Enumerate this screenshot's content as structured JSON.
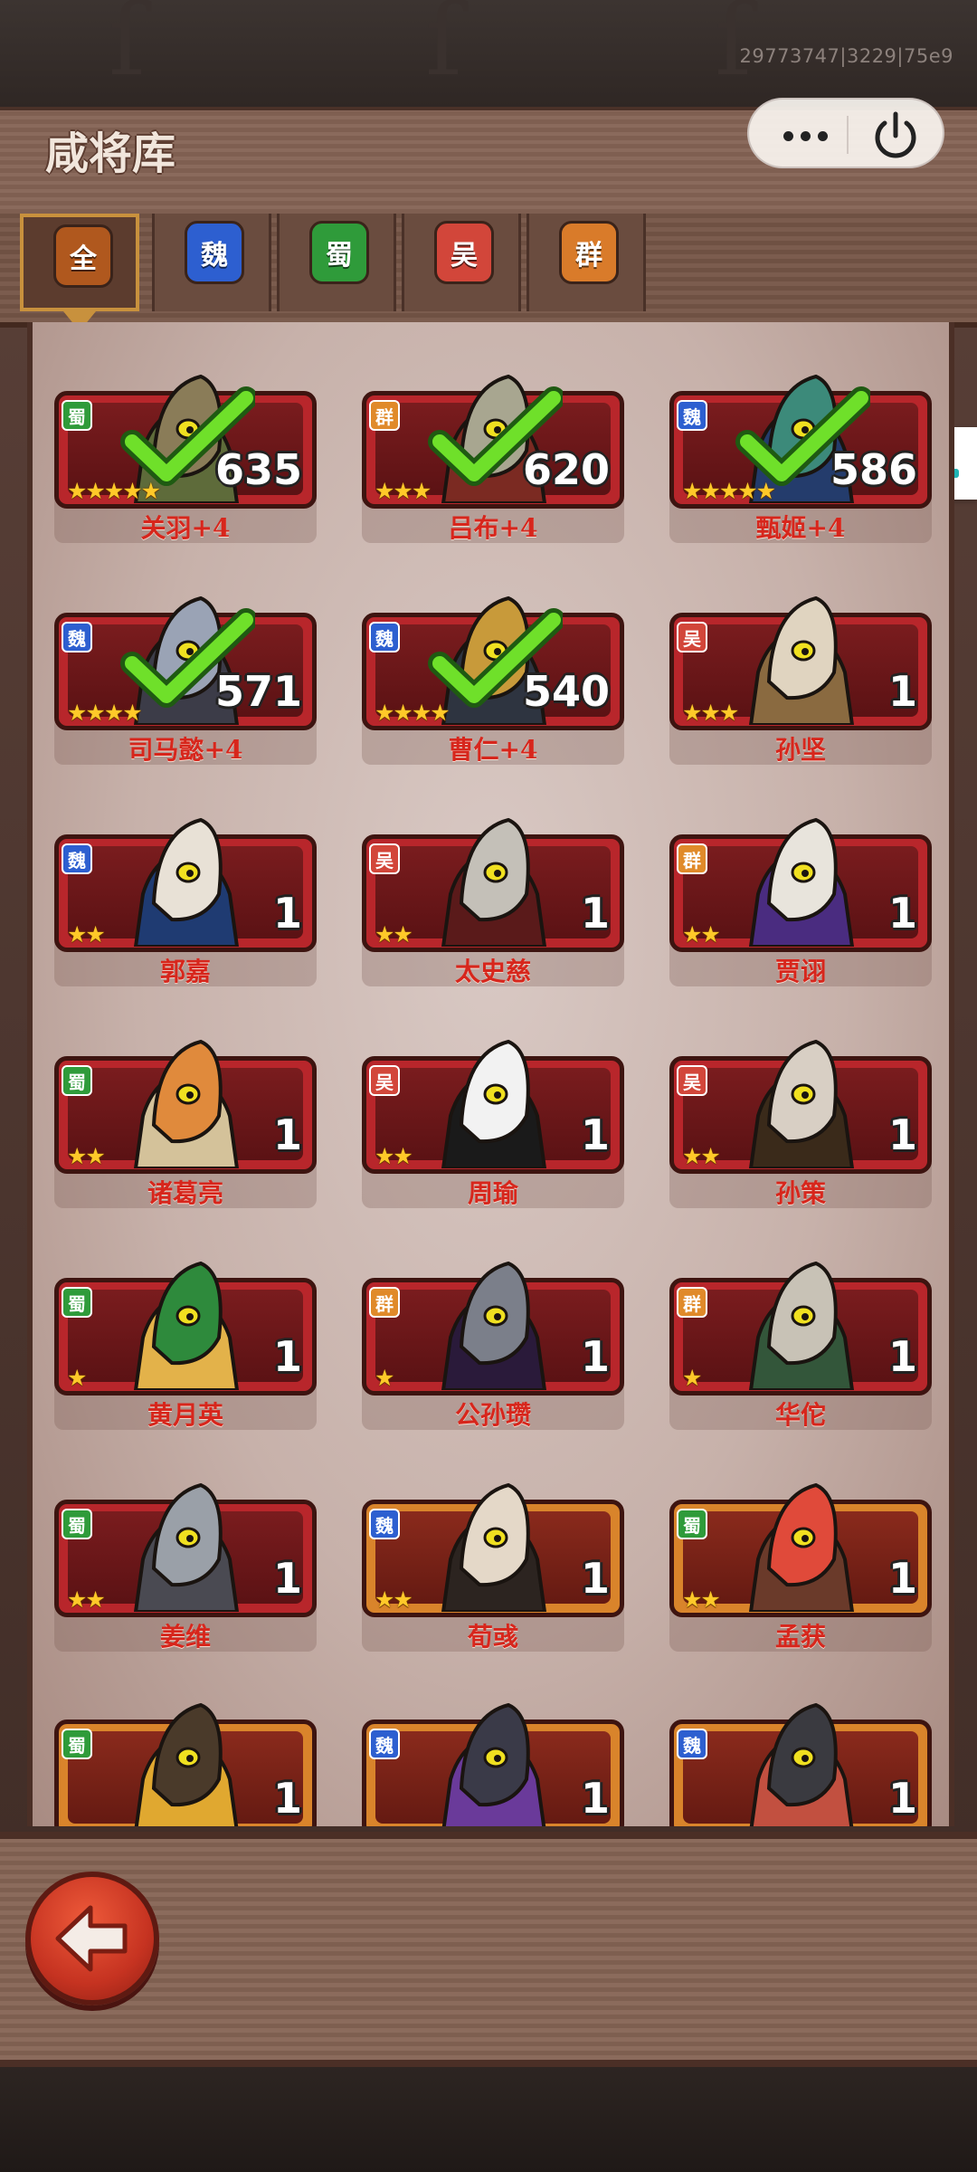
{
  "version": "29773747|3229|75e9",
  "title": "咸将库",
  "tabs": [
    {
      "label": "全",
      "color": "#b0581e",
      "active": true
    },
    {
      "label": "魏",
      "color": "#2d5fd0",
      "active": false
    },
    {
      "label": "蜀",
      "color": "#2f9b3a",
      "active": false
    },
    {
      "label": "吴",
      "color": "#d2463a",
      "active": false
    },
    {
      "label": "群",
      "color": "#d97b2a",
      "active": false
    }
  ],
  "faction_colors": {
    "魏": "#2d5fd0",
    "蜀": "#2f9b3a",
    "吴": "#d2463a",
    "群": "#e08a2a"
  },
  "heroes": [
    {
      "name": "关羽+4",
      "faction": "蜀",
      "stars": 5,
      "count": "635",
      "checked": true,
      "frame": "red"
    },
    {
      "name": "吕布+4",
      "faction": "群",
      "stars": 3,
      "count": "620",
      "checked": true,
      "frame": "red"
    },
    {
      "name": "甄姬+4",
      "faction": "魏",
      "stars": 5,
      "count": "586",
      "checked": true,
      "frame": "red"
    },
    {
      "name": "司马懿+4",
      "faction": "魏",
      "stars": 4,
      "count": "571",
      "checked": true,
      "frame": "red"
    },
    {
      "name": "曹仁+4",
      "faction": "魏",
      "stars": 4,
      "count": "540",
      "checked": true,
      "frame": "red"
    },
    {
      "name": "孙坚",
      "faction": "吴",
      "stars": 3,
      "count": "1",
      "checked": false,
      "frame": "red"
    },
    {
      "name": "郭嘉",
      "faction": "魏",
      "stars": 2,
      "count": "1",
      "checked": false,
      "frame": "red"
    },
    {
      "name": "太史慈",
      "faction": "吴",
      "stars": 2,
      "count": "1",
      "checked": false,
      "frame": "red"
    },
    {
      "name": "贾诩",
      "faction": "群",
      "stars": 2,
      "count": "1",
      "checked": false,
      "frame": "red"
    },
    {
      "name": "诸葛亮",
      "faction": "蜀",
      "stars": 2,
      "count": "1",
      "checked": false,
      "frame": "red"
    },
    {
      "name": "周瑜",
      "faction": "吴",
      "stars": 2,
      "count": "1",
      "checked": false,
      "frame": "red"
    },
    {
      "name": "孙策",
      "faction": "吴",
      "stars": 2,
      "count": "1",
      "checked": false,
      "frame": "red"
    },
    {
      "name": "黄月英",
      "faction": "蜀",
      "stars": 1,
      "count": "1",
      "checked": false,
      "frame": "red"
    },
    {
      "name": "公孙瓒",
      "faction": "群",
      "stars": 1,
      "count": "1",
      "checked": false,
      "frame": "red"
    },
    {
      "name": "华佗",
      "faction": "群",
      "stars": 1,
      "count": "1",
      "checked": false,
      "frame": "red"
    },
    {
      "name": "姜维",
      "faction": "蜀",
      "stars": 2,
      "count": "1",
      "checked": false,
      "frame": "red"
    },
    {
      "name": "荀彧",
      "faction": "魏",
      "stars": 2,
      "count": "1",
      "checked": false,
      "frame": "gold"
    },
    {
      "name": "孟获",
      "faction": "蜀",
      "stars": 2,
      "count": "1",
      "checked": false,
      "frame": "gold"
    },
    {
      "name": "",
      "faction": "蜀",
      "stars": 0,
      "count": "1",
      "checked": false,
      "frame": "gold"
    },
    {
      "name": "",
      "faction": "魏",
      "stars": 0,
      "count": "1",
      "checked": false,
      "frame": "gold"
    },
    {
      "name": "",
      "faction": "魏",
      "stars": 0,
      "count": "1",
      "checked": false,
      "frame": "gold"
    }
  ],
  "icons": {
    "more": "more-dots-icon",
    "power": "power-icon",
    "back": "back-arrow-icon",
    "side": "joystick-icon"
  }
}
